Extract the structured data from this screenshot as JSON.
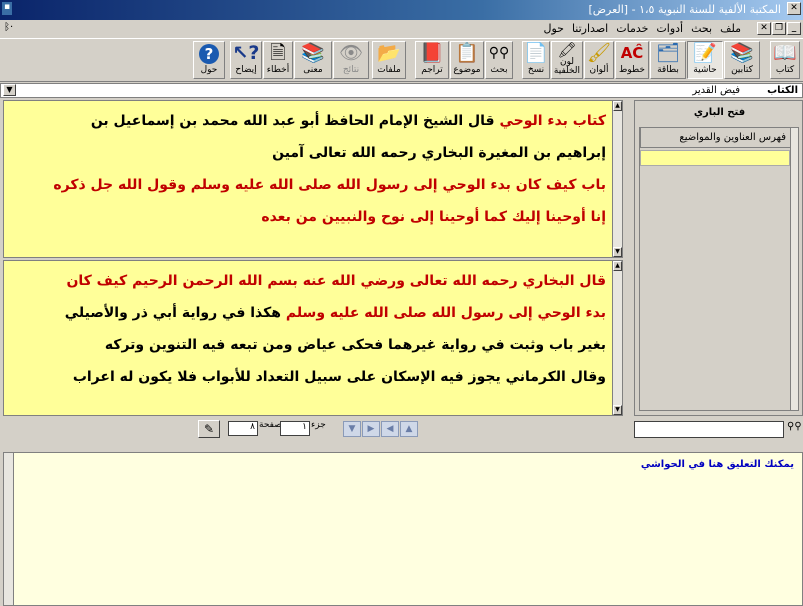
{
  "window": {
    "title": "المكتبة الألفية للسنة النبوية ١،٥ - [العرض]"
  },
  "menu": {
    "items": [
      "ملف",
      "بحث",
      "أدوات",
      "خدمات",
      "اصدارتنا",
      "حول"
    ]
  },
  "toolbar": {
    "buttons": [
      {
        "label": "كتاب",
        "icon": "book-icon",
        "state": "normal"
      },
      {
        "label": "كتابين",
        "icon": "two-books-icon",
        "state": "normal"
      },
      {
        "label": "حاشية",
        "icon": "margin-note-icon",
        "state": "pressed"
      },
      {
        "label": "بطاقة",
        "icon": "card-icon",
        "state": "normal"
      },
      {
        "label": "خطوط",
        "icon": "fonts-icon",
        "state": "normal"
      },
      {
        "label": "ألوان",
        "icon": "colors-icon",
        "state": "normal"
      },
      {
        "label": "لون الخلفية",
        "icon": "background-color-icon",
        "state": "normal"
      },
      {
        "label": "نسخ",
        "icon": "copy-icon",
        "state": "normal"
      },
      {
        "label": "بحث",
        "icon": "binoculars-icon",
        "state": "normal"
      },
      {
        "label": "موضوع",
        "icon": "topic-icon",
        "state": "normal"
      },
      {
        "label": "تراجم",
        "icon": "biographies-icon",
        "state": "normal"
      },
      {
        "label": "ملفات",
        "icon": "folder-icon",
        "state": "normal"
      },
      {
        "label": "نتائج",
        "icon": "eye-icon",
        "state": "disabled"
      },
      {
        "label": "معنى",
        "icon": "library-icon",
        "state": "normal"
      },
      {
        "label": "أخطاء",
        "icon": "errors-icon",
        "state": "normal"
      },
      {
        "label": "إيضاح",
        "icon": "help-pointer-icon",
        "state": "normal"
      },
      {
        "label": "حول",
        "icon": "question-icon",
        "state": "normal"
      }
    ]
  },
  "addressbar": {
    "book_label": "الكتاب",
    "book_name": "فيض القدير"
  },
  "pane1": {
    "lines": [
      [
        {
          "t": "كتاب بدء الوحي",
          "c": "red"
        },
        {
          "t": " قال الشيخ الإمام الحافظ أبو عبد الله محمد بن إسماعيل بن",
          "c": "blk"
        }
      ],
      [
        {
          "t": "إبراهيم بن المغيرة البخاري رحمه الله تعالى آمين",
          "c": "blk"
        }
      ],
      [
        {
          "t": "باب كيف كان بدء الوحي إلى رسول الله صلى الله عليه وسلم وقول الله جل ذكره",
          "c": "red"
        }
      ],
      [
        {
          "t": "إنا أوحينا إليك كما أوحينا إلى نوح والنبيين من بعده",
          "c": "red"
        }
      ]
    ]
  },
  "pane2": {
    "lines": [
      [
        {
          "t": "قال البخاري رحمه الله تعالى ورضي الله عنه بسم الله الرحمن الرحيم كيف كان",
          "c": "red"
        }
      ],
      [
        {
          "t": "بدء الوحي إلى رسول الله صلى الله عليه وسلم",
          "c": "red"
        },
        {
          "t": " هكذا في رواية أبي ذر والأصيلي",
          "c": "blk"
        }
      ],
      [
        {
          "t": "بغير باب وثبت في رواية غيرهما فحكى عياض ومن تبعه فيه التنوين وتركه",
          "c": "blk"
        }
      ],
      [
        {
          "t": "وقال الكرماني يجوز فيه الإسكان على سبيل التعداد للأبواب فلا يكون له اعراب",
          "c": "blk"
        }
      ]
    ]
  },
  "nav": {
    "part_label": "جزء",
    "part_value": "١",
    "page_label": "صفحة",
    "page_value": "٨"
  },
  "sidepanel": {
    "title": "فتح الباري",
    "tree_header": "فهرس العناوين والمواضيع"
  },
  "notes": {
    "hint": "يمكنك التعليق هنا في الحواشي"
  }
}
